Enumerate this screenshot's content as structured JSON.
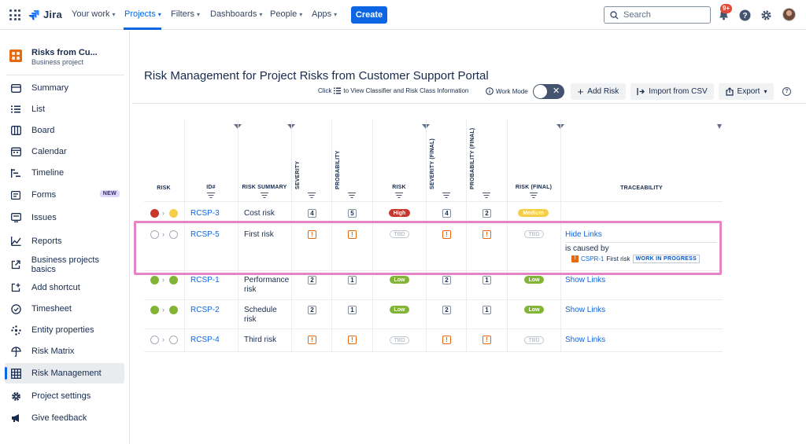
{
  "nav": {
    "product": "Jira",
    "items": [
      "Your work",
      "Projects",
      "Filters",
      "Dashboards",
      "People",
      "Apps"
    ],
    "create_label": "Create",
    "search_placeholder": "Search",
    "notification_count": "9+"
  },
  "sidebar": {
    "project_name": "Risks from Cu...",
    "project_type": "Business project",
    "items": [
      {
        "label": "Summary",
        "icon": "summary-icon"
      },
      {
        "label": "List",
        "icon": "list-icon"
      },
      {
        "label": "Board",
        "icon": "board-icon"
      },
      {
        "label": "Calendar",
        "icon": "calendar-icon"
      },
      {
        "label": "Timeline",
        "icon": "timeline-icon"
      },
      {
        "label": "Forms",
        "icon": "forms-icon",
        "badge": "NEW"
      },
      {
        "label": "Issues",
        "icon": "issues-icon"
      },
      {
        "label": "Reports",
        "icon": "reports-icon"
      },
      {
        "label": "Business projects basics",
        "icon": "external-link-icon"
      },
      {
        "label": "Add shortcut",
        "icon": "add-shortcut-icon"
      },
      {
        "label": "Timesheet",
        "icon": "timesheet-icon"
      },
      {
        "label": "Entity properties",
        "icon": "entity-properties-icon"
      },
      {
        "label": "Risk Matrix",
        "icon": "risk-matrix-icon"
      },
      {
        "label": "Risk Management",
        "icon": "risk-management-icon",
        "active": true
      },
      {
        "label": "Project settings",
        "icon": "settings-icon"
      },
      {
        "label": "Give feedback",
        "icon": "megaphone-icon"
      }
    ]
  },
  "main": {
    "title": "Risk Management for Project Risks from Customer Support Portal",
    "hint_prefix": "Click",
    "hint_suffix": "to View Classifier and Risk Class Information",
    "work_mode_label": "Work Mode",
    "add_risk_label": "Add Risk",
    "import_label": "Import from CSV",
    "export_label": "Export"
  },
  "table": {
    "headers": {
      "risk": "RISK",
      "id": "ID#",
      "summary": "RISK SUMMARY",
      "severity": "SEVERITY",
      "probability": "PROBABILITY",
      "risk2": "RISK",
      "severity_final": "SEVERITY (FINAL)",
      "probability_final": "PROBABILITY (FINAL)",
      "risk_final": "RISK (FINAL)",
      "traceability": "TRACEABILITY"
    },
    "rows": [
      {
        "id": "RCSP-3",
        "summary": "Cost risk",
        "severity": "4",
        "probability": "5",
        "risk": "High",
        "severity_final": "4",
        "probability_final": "2",
        "risk_final": "Medium",
        "trace": ""
      },
      {
        "id": "RCSP-5",
        "summary": "First risk",
        "severity": "!",
        "probability": "!",
        "risk": "TBD",
        "severity_final": "!",
        "probability_final": "!",
        "risk_final": "TBD",
        "trace": "Hide Links"
      },
      {
        "id": "RCSP-1",
        "summary": "Performance risk",
        "severity": "2",
        "probability": "1",
        "risk": "Low",
        "severity_final": "2",
        "probability_final": "1",
        "risk_final": "Low",
        "trace": "Show Links"
      },
      {
        "id": "RCSP-2",
        "summary": "Schedule risk",
        "severity": "2",
        "probability": "1",
        "risk": "Low",
        "severity_final": "2",
        "probability_final": "1",
        "risk_final": "Low",
        "trace": "Show Links"
      },
      {
        "id": "RCSP-4",
        "summary": "Third risk",
        "severity": "!",
        "probability": "!",
        "risk": "TBD",
        "severity_final": "!",
        "probability_final": "!",
        "risk_final": "TBD",
        "trace": "Show Links"
      }
    ],
    "link_detail": {
      "relation": "is caused by",
      "issue_key": "CSPR-1",
      "issue_summary": "First risk",
      "status": "WORK IN PROGRESS"
    }
  },
  "colors": {
    "accent": "#0c66e4",
    "high": "#c9372c",
    "medium": "#f5cd47",
    "low": "#82b536",
    "highlight": "#e385c7"
  }
}
